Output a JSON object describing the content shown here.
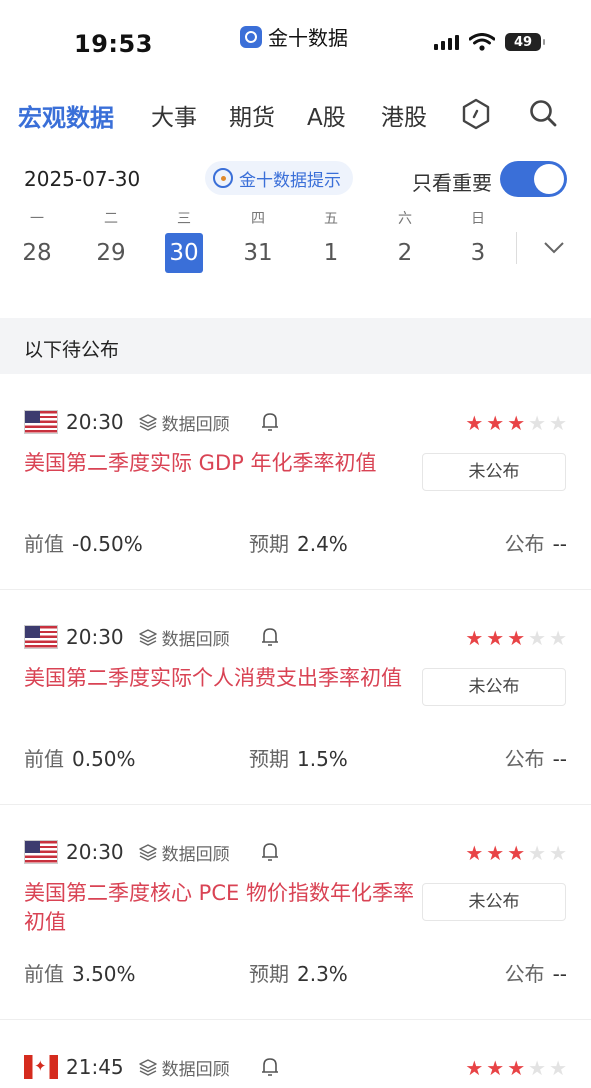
{
  "status_bar": {
    "time": "19:53",
    "app_name": "金十数据",
    "battery": "49"
  },
  "nav": {
    "tabs": [
      "宏观数据",
      "大事",
      "期货",
      "A股",
      "港股"
    ],
    "active_tab": "宏观数据",
    "icons": [
      "hexagon-settings-icon",
      "search-icon"
    ]
  },
  "date_bar": {
    "date": "2025-07-30",
    "hint": "金十数据提示",
    "important_label": "只看重要",
    "important_only": true
  },
  "week": {
    "days": [
      {
        "dow": "一",
        "num": "28"
      },
      {
        "dow": "二",
        "num": "29"
      },
      {
        "dow": "三",
        "num": "30"
      },
      {
        "dow": "四",
        "num": "31"
      },
      {
        "dow": "五",
        "num": "1"
      },
      {
        "dow": "六",
        "num": "2"
      },
      {
        "dow": "日",
        "num": "3"
      }
    ],
    "selected": "30"
  },
  "section": {
    "title": "以下待公布"
  },
  "labels": {
    "review": "数据回顾",
    "prev": "前值",
    "forecast": "预期",
    "actual": "公布"
  },
  "events": [
    {
      "country": "us",
      "time": "20:30",
      "title": "美国第二季度实际 GDP 年化季率初值",
      "stars": 3,
      "status": "未公布",
      "prev": "-0.50%",
      "forecast": "2.4%",
      "actual": "--"
    },
    {
      "country": "us",
      "time": "20:30",
      "title": "美国第二季度实际个人消费支出季率初值",
      "stars": 3,
      "status": "未公布",
      "prev": "0.50%",
      "forecast": "1.5%",
      "actual": "--"
    },
    {
      "country": "us",
      "time": "20:30",
      "title": "美国第二季度核心 PCE 物价指数年化季率初值",
      "stars": 3,
      "status": "未公布",
      "prev": "3.50%",
      "forecast": "2.3%",
      "actual": "--"
    },
    {
      "country": "ca",
      "time": "21:45",
      "stars": 3
    }
  ],
  "colors": {
    "accent": "#3a6fd8",
    "event_title": "#d94354",
    "star_on": "#e84346",
    "star_off": "#e3e3e3"
  }
}
